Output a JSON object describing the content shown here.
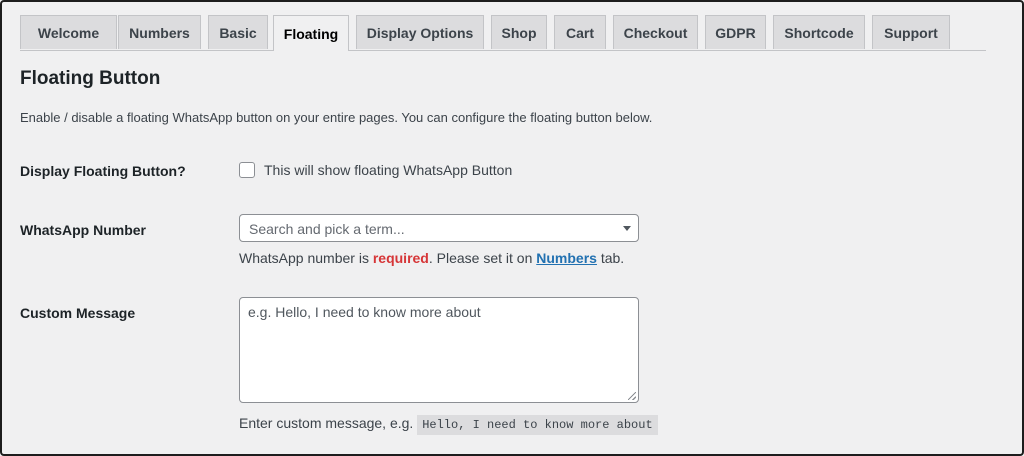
{
  "tabs": [
    "Welcome",
    "Numbers",
    "Basic",
    "Floating",
    "Display Options",
    "Shop",
    "Cart",
    "Checkout",
    "GDPR",
    "Shortcode",
    "Support"
  ],
  "active_tab": "Floating",
  "title": "Floating Button",
  "description": "Enable / disable a floating WhatsApp button on your entire pages. You can configure the floating button below.",
  "display_floating": {
    "label": "Display Floating Button?",
    "checkbox_text": "This will show floating WhatsApp Button",
    "checked": false
  },
  "whatsapp_number": {
    "label": "WhatsApp Number",
    "placeholder": "Search and pick a term...",
    "help_prefix": "WhatsApp number is ",
    "help_required": "required",
    "help_middle": ". Please set it on ",
    "help_link": "Numbers",
    "help_suffix": " tab."
  },
  "custom_message": {
    "label": "Custom Message",
    "placeholder": "e.g. Hello, I need to know more about",
    "help_prefix": "Enter custom message, e.g. ",
    "help_code": "Hello, I need to know more about"
  },
  "icons": {
    "dropdown": "chevron-down-icon",
    "resize": "resize-grip-icon"
  },
  "colors": {
    "link": "#2271b1",
    "required": "#d63638",
    "background": "#f0f0f1"
  }
}
